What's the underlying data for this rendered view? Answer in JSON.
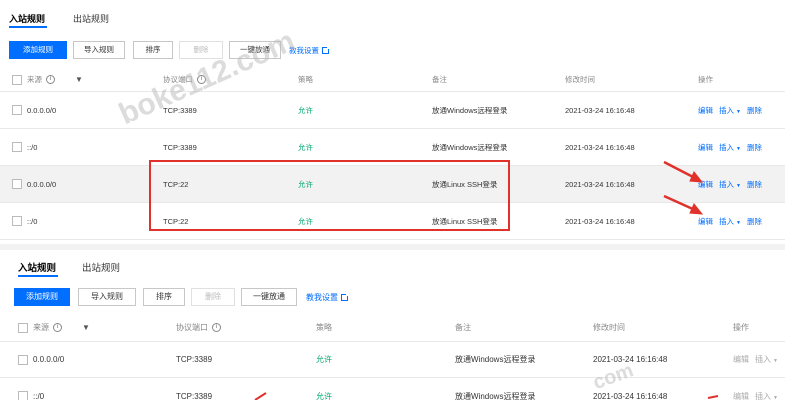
{
  "tabs": {
    "inbound": "入站规则",
    "outbound": "出站规则"
  },
  "toolbar": {
    "add": "添加规则",
    "import": "导入规则",
    "sort": "排序",
    "delete": "删除",
    "allow_all": "一键放通",
    "help": "教我设置"
  },
  "columns": {
    "source": "来源",
    "port": "协议端口",
    "policy": "策略",
    "remark": "备注",
    "modified": "修改时间",
    "actions": "操作"
  },
  "rows": [
    {
      "source": "0.0.0.0/0",
      "port": "TCP:3389",
      "policy": "允许",
      "remark": "放通Windows远程登录",
      "modified": "2021-03-24 16:16:48"
    },
    {
      "source": "::/0",
      "port": "TCP:3389",
      "policy": "允许",
      "remark": "放通Windows远程登录",
      "modified": "2021-03-24 16:16:48"
    },
    {
      "source": "0.0.0.0/0",
      "port": "TCP:22",
      "policy": "允许",
      "remark": "放通Linux SSH登录",
      "modified": "2021-03-24 16:16:48"
    },
    {
      "source": "::/0",
      "port": "TCP:22",
      "policy": "允许",
      "remark": "放通Linux SSH登录",
      "modified": "2021-03-24 16:16:48"
    }
  ],
  "row_actions": {
    "edit": "编辑",
    "insert": "插入",
    "delete": "删除"
  },
  "watermark": {
    "main": "boke112.com",
    "small": "com"
  },
  "colors": {
    "accent": "#006eff",
    "allow": "#00a870",
    "annotation": "#e0322b",
    "highlight_row": "#f2f2f2"
  }
}
